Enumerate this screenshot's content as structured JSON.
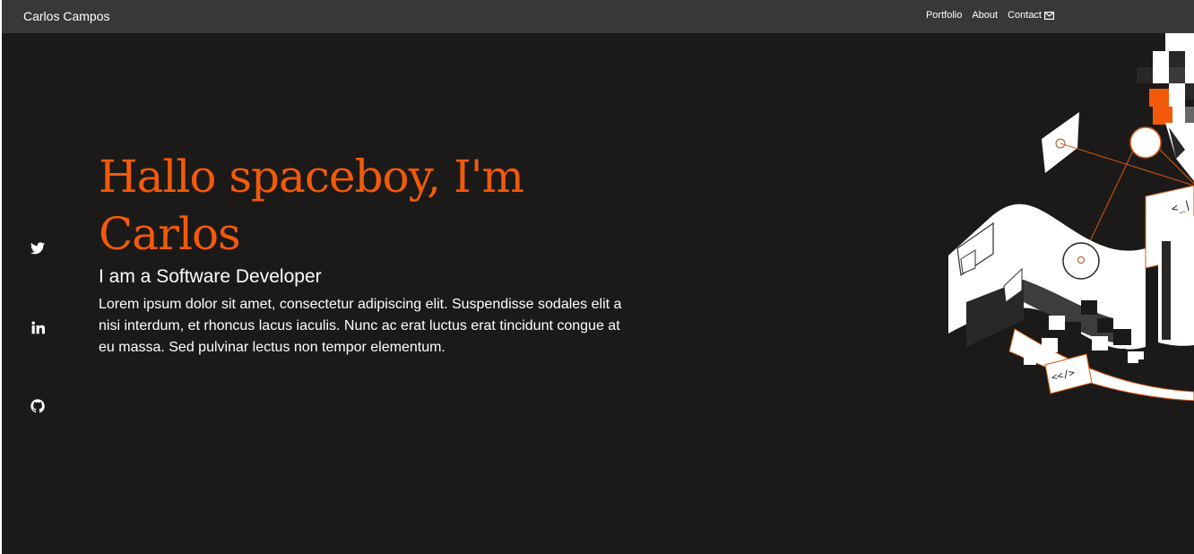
{
  "navbar": {
    "brand": "Carlos Campos",
    "links": [
      {
        "label": "Portfolio"
      },
      {
        "label": "About"
      },
      {
        "label": "Contact"
      }
    ]
  },
  "social": [
    {
      "icon": "twitter-icon"
    },
    {
      "icon": "linkedin-icon"
    },
    {
      "icon": "github-icon"
    }
  ],
  "hero": {
    "title": "Hallo spaceboy, I'm Carlos",
    "subtitle": "I am a Software Developer",
    "text": "Lorem ipsum dolor sit amet, consectetur adipiscing elit. Suspendisse sodales elit a nisi interdum, et rhoncus lacus iaculis. Nunc ac erat luctus erat tincidunt congue at eu massa. Sed pulvinar lectus non tempor elementum."
  },
  "illustration": {
    "code_tag_1": "<_|",
    "code_tag_2": "<</>"
  },
  "colors": {
    "background": "#1c1a19",
    "navbar": "#3a3837",
    "accent": "#f25a0a",
    "text": "#ffffff"
  }
}
